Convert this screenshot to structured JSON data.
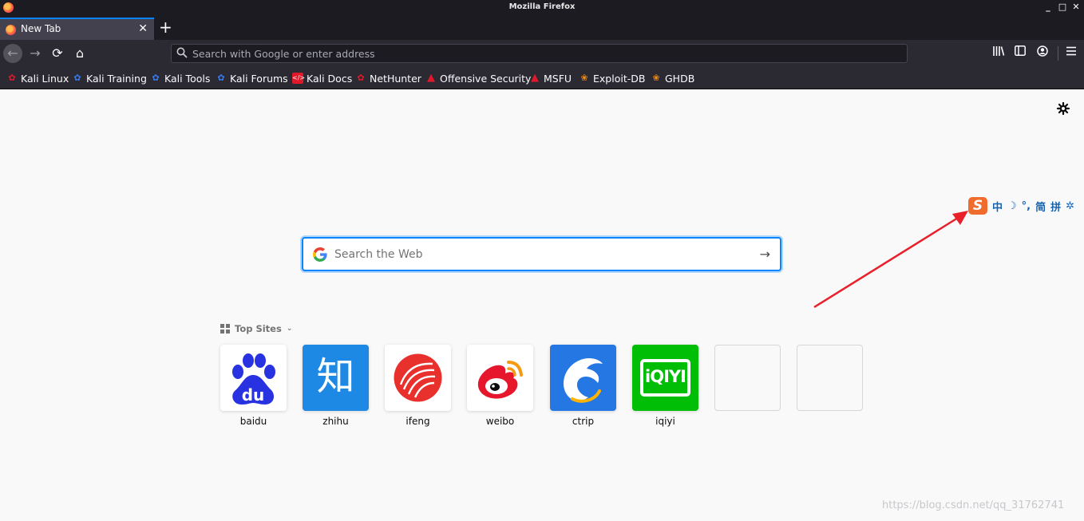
{
  "window": {
    "title": "Mozilla Firefox",
    "minimize": "_",
    "maximize": "□",
    "close": "✕"
  },
  "tabs": [
    {
      "label": "New Tab",
      "close": "✕"
    }
  ],
  "newtab_label": "+",
  "navbar": {
    "back": "←",
    "forward": "→",
    "reload": "⟳",
    "home": "⌂",
    "url_placeholder": "Search with Google or enter address"
  },
  "bookmarks": [
    {
      "label": "Kali Linux",
      "icon": "kali-dragon-icon",
      "color": "#e0192a"
    },
    {
      "label": "Kali Training",
      "icon": "kali-training-icon",
      "color": "#367bf0"
    },
    {
      "label": "Kali Tools",
      "icon": "kali-tools-icon",
      "color": "#367bf0"
    },
    {
      "label": "Kali Forums",
      "icon": "kali-forums-icon",
      "color": "#367bf0"
    },
    {
      "label": "Kali Docs",
      "icon": "kali-docs-icon",
      "color": "#e0192a"
    },
    {
      "label": "NetHunter",
      "icon": "nethunter-icon",
      "color": "#e0192a"
    },
    {
      "label": "Offensive Security",
      "icon": "offsec-icon",
      "color": "#e0192a"
    },
    {
      "label": "MSFU",
      "icon": "msfu-icon",
      "color": "#e0192a"
    },
    {
      "label": "Exploit-DB",
      "icon": "exploit-db-icon",
      "color": "#ee8a16"
    },
    {
      "label": "GHDB",
      "icon": "ghdb-icon",
      "color": "#ee8a16"
    }
  ],
  "settings_icon": "gear-icon",
  "ime": {
    "logo": "S",
    "items": [
      "中",
      "☽",
      "°,",
      "简",
      "拼",
      "✲"
    ]
  },
  "search": {
    "placeholder": "Search the Web"
  },
  "top_sites": {
    "header": "Top Sites",
    "sites": [
      {
        "label": "baidu",
        "tile_color": "#ffffff"
      },
      {
        "label": "zhihu",
        "tile_color": "#1e88e5",
        "glyph": "知"
      },
      {
        "label": "ifeng",
        "tile_color": "#ffffff"
      },
      {
        "label": "weibo",
        "tile_color": "#ffffff"
      },
      {
        "label": "ctrip",
        "tile_color": "#2577e3"
      },
      {
        "label": "iqiyi",
        "tile_color": "#00be06",
        "glyph": "iQIYI"
      }
    ]
  },
  "watermark": "https://blog.csdn.net/qq_31762741",
  "colors": {
    "accent": "#0a84ff",
    "annotation_arrow": "#e8202a"
  }
}
